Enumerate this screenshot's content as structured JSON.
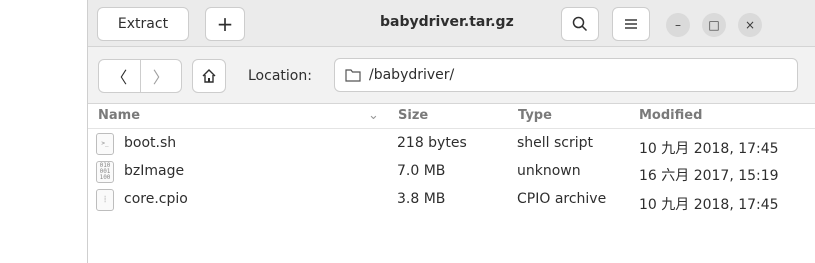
{
  "header": {
    "extract_label": "Extract",
    "plus_label": "+",
    "title": "babydriver.tar.gz",
    "minimize_glyph": "–",
    "maximize_glyph": "□",
    "close_glyph": "×"
  },
  "location": {
    "back_glyph": "〈",
    "forward_glyph": "〉",
    "label": "Location:",
    "path": "/babydriver/"
  },
  "columns": {
    "name": "Name",
    "size": "Size",
    "type": "Type",
    "modified": "Modified"
  },
  "files": [
    {
      "name": "boot.sh",
      "size": "218 bytes",
      "type": "shell script",
      "modified": "10 九月 2018, 17:45",
      "icon": "script-file-icon"
    },
    {
      "name": "bzImage",
      "size": "7.0 MB",
      "type": "unknown",
      "modified": "16 六月 2017, 15:19",
      "icon": "binary-file-icon"
    },
    {
      "name": "core.cpio",
      "size": "3.8 MB",
      "type": "CPIO archive",
      "modified": "10 九月 2018, 17:45",
      "icon": "archive-file-icon"
    }
  ]
}
